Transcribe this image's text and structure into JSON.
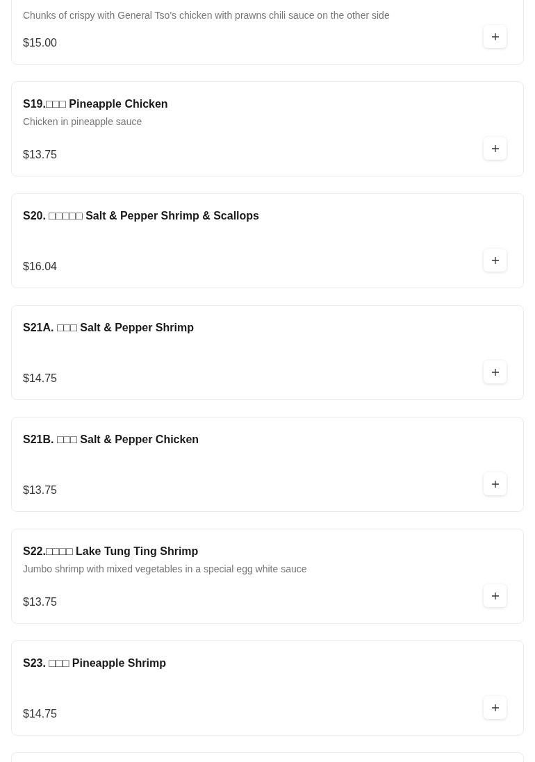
{
  "items": [
    {
      "description": "Chunks of crispy with General Tso's chicken with prawns chili sauce on the other side",
      "price": "$15.00"
    },
    {
      "name": "S19.□□□ Pineapple Chicken",
      "description": "Chicken in pineapple sauce",
      "price": "$13.75"
    },
    {
      "name": "S20. □□□□□ Salt & Pepper Shrimp & Scallops",
      "price": "$16.04"
    },
    {
      "name": "S21A. □□□ Salt & Pepper Shrimp",
      "price": "$14.75"
    },
    {
      "name": "S21B. □□□ Salt & Pepper Chicken",
      "price": "$13.75"
    },
    {
      "name": "S22.□□□□ Lake Tung Ting Shrimp",
      "description": "Jumbo shrimp with mixed vegetables in a special egg white sauce",
      "price": "$13.75"
    },
    {
      "name": "S23. □□□ Pineapple Shrimp",
      "price": "$14.75"
    }
  ]
}
